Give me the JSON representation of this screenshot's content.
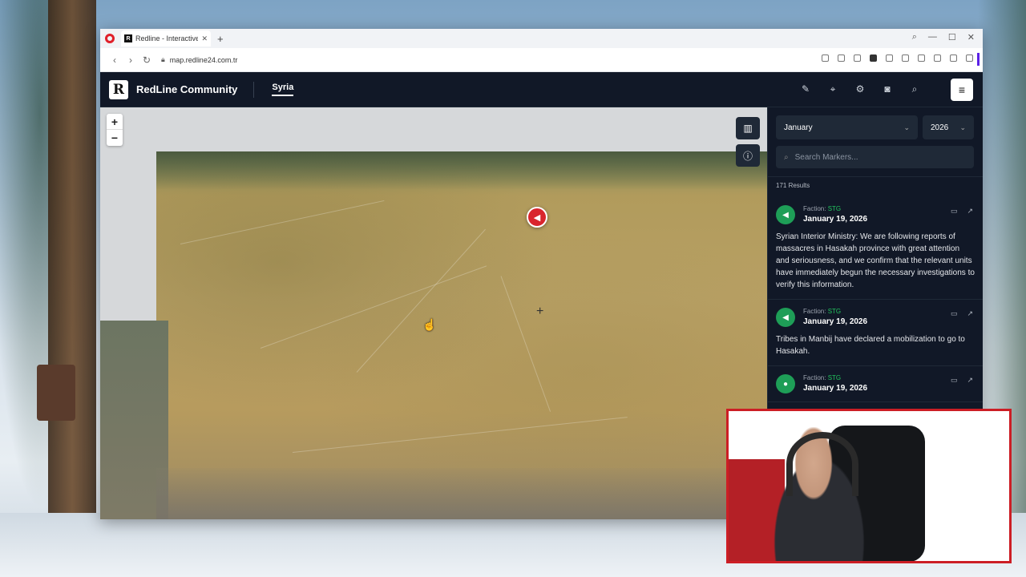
{
  "browser": {
    "tab_title": "Redline - Interactive Strat",
    "tab_favicon": "R",
    "url": "map.redline24.com.tr"
  },
  "app": {
    "brand_logo": "R",
    "brand_name": "RedLine Community",
    "nav_active": "Syria"
  },
  "map": {
    "zoom_in": "+",
    "zoom_out": "−",
    "marker_color": "#d9252d"
  },
  "panel": {
    "month": "January",
    "year": "2026",
    "search_placeholder": "Search Markers...",
    "results": "171 Results",
    "items": [
      {
        "faction_label": "Faction:",
        "faction": "STG",
        "date": "January 19, 2026",
        "text": "Syrian Interior Ministry: We are following reports of massacres in Hasakah province with great attention and seriousness, and we confirm that the relevant units have immediately begun the necessary investigations to verify this information."
      },
      {
        "faction_label": "Faction:",
        "faction": "STG",
        "date": "January 19, 2026",
        "text": "Tribes in Manbij have declared a mobilization to go to Hasakah."
      },
      {
        "faction_label": "Faction:",
        "faction": "STG",
        "date": "January 19, 2026",
        "text": ""
      }
    ]
  },
  "colors": {
    "app_bg": "#111827",
    "accent_green": "#22c55e",
    "marker_red": "#d9252d"
  }
}
